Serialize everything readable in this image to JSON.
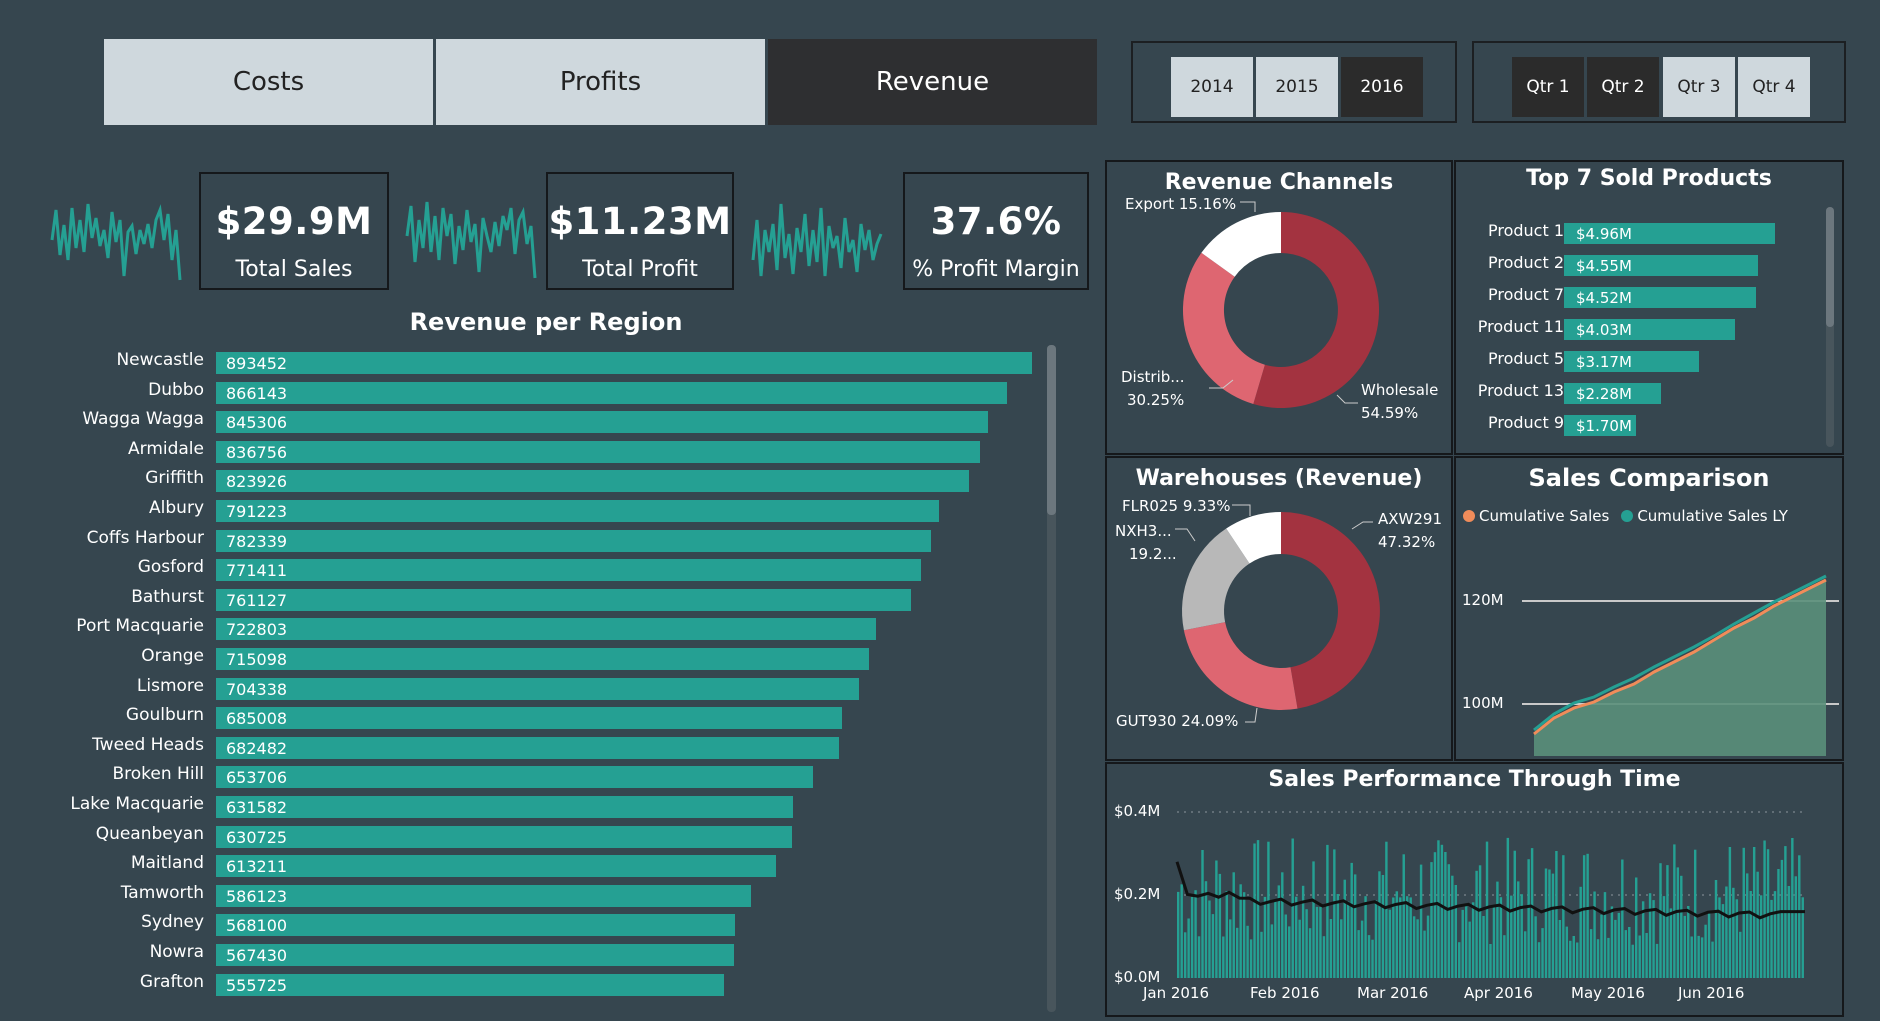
{
  "nav": {
    "tabs": [
      {
        "label": "Costs",
        "active": false
      },
      {
        "label": "Profits",
        "active": false
      },
      {
        "label": "Revenue",
        "active": true
      }
    ]
  },
  "years": [
    {
      "label": "2014",
      "selected": false
    },
    {
      "label": "2015",
      "selected": false
    },
    {
      "label": "2016",
      "selected": true
    }
  ],
  "quarters": [
    {
      "label": "Qtr 1",
      "selected": true
    },
    {
      "label": "Qtr 2",
      "selected": true
    },
    {
      "label": "Qtr 3",
      "selected": false
    },
    {
      "label": "Qtr 4",
      "selected": false
    }
  ],
  "kpis": [
    {
      "value": "$29.9M",
      "label": "Total Sales"
    },
    {
      "value": "$11.23M",
      "label": "Total Profit"
    },
    {
      "value": "37.6%",
      "label": "% Profit Margin"
    }
  ],
  "colors": {
    "teal": "#25a093",
    "background": "#36464f",
    "dark_red": "#a33340",
    "light_red": "#de6671",
    "orange": "#f08c5a",
    "white": "#ffffff",
    "grey": "#b8b8b8"
  },
  "region_chart": {
    "title": "Revenue per Region",
    "chart_data": {
      "type": "bar",
      "orientation": "horizontal",
      "categories": [
        "Newcastle",
        "Dubbo",
        "Wagga Wagga",
        "Armidale",
        "Griffith",
        "Albury",
        "Coffs Harbour",
        "Gosford",
        "Bathurst",
        "Port Macquarie",
        "Orange",
        "Lismore",
        "Goulburn",
        "Tweed Heads",
        "Broken Hill",
        "Lake Macquarie",
        "Queanbeyan",
        "Maitland",
        "Tamworth",
        "Sydney",
        "Nowra",
        "Grafton"
      ],
      "values": [
        893452,
        866143,
        845306,
        836756,
        823926,
        791223,
        782339,
        771411,
        761127,
        722803,
        715098,
        704338,
        685008,
        682482,
        653706,
        631582,
        630725,
        613211,
        586123,
        568100,
        567430,
        555725
      ]
    }
  },
  "channels": {
    "title": "Revenue Channels",
    "chart_data": {
      "type": "pie",
      "donut": true,
      "categories": [
        "Wholesale",
        "Distributor",
        "Export"
      ],
      "values": [
        54.59,
        30.25,
        15.16
      ],
      "labels": [
        {
          "name": "Wholesale",
          "pct": "54.59%"
        },
        {
          "name": "Distrib...",
          "pct": "30.25%"
        },
        {
          "name": "Export",
          "pct": "15.16%"
        }
      ]
    }
  },
  "top_products": {
    "title": "Top 7 Sold Products",
    "chart_data": {
      "type": "bar",
      "orientation": "horizontal",
      "categories": [
        "Product 1",
        "Product 2",
        "Product 7",
        "Product 11",
        "Product 5",
        "Product 13",
        "Product 9"
      ],
      "values": [
        4.96,
        4.55,
        4.52,
        4.03,
        3.17,
        2.28,
        1.7
      ],
      "value_labels": [
        "$4.96M",
        "$4.55M",
        "$4.52M",
        "$4.03M",
        "$3.17M",
        "$2.28M",
        "$1.70M"
      ]
    }
  },
  "warehouses": {
    "title": "Warehouses (Revenue)",
    "chart_data": {
      "type": "pie",
      "donut": true,
      "categories": [
        "AXW291",
        "GUT930",
        "NXH3...",
        "FLR025"
      ],
      "values": [
        47.32,
        24.09,
        19.2,
        9.33
      ],
      "labels": [
        {
          "name": "AXW291",
          "pct": "47.32%"
        },
        {
          "name": "GUT930",
          "pct": "24.09%"
        },
        {
          "name": "NXH3...",
          "pct": "19.2..."
        },
        {
          "name": "FLR025",
          "pct": "9.33%"
        }
      ]
    }
  },
  "sales_comparison": {
    "title": "Sales Comparison",
    "legend": [
      "Cumulative Sales",
      "Cumulative Sales LY"
    ],
    "chart_data": {
      "type": "area",
      "y_ticks": [
        "120M",
        "100M"
      ],
      "series": [
        {
          "name": "Cumulative Sales",
          "start": 95,
          "end": 129
        },
        {
          "name": "Cumulative Sales LY",
          "start": 96,
          "end": 130
        }
      ]
    }
  },
  "performance": {
    "title": "Sales Performance Through Time",
    "chart_data": {
      "type": "bar",
      "y_ticks": [
        "$0.4M",
        "$0.2M",
        "$0.0M"
      ],
      "x_ticks": [
        "Jan 2016",
        "Feb 2016",
        "Mar 2016",
        "Apr 2016",
        "May 2016",
        "Jun 2016"
      ],
      "ylim": [
        0,
        0.4
      ],
      "trend_start": 0.28,
      "trend_mid": 0.19,
      "trend_end": 0.16
    }
  }
}
